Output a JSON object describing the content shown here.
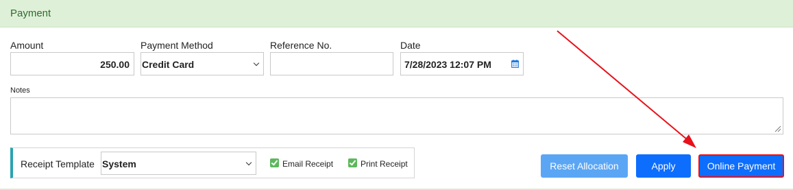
{
  "panel": {
    "title": "Payment"
  },
  "form": {
    "amount_label": "Amount",
    "amount_value": "250.00",
    "payment_method_label": "Payment Method",
    "payment_method_value": "Credit Card",
    "reference_label": "Reference No.",
    "reference_value": "",
    "date_label": "Date",
    "date_value": "7/28/2023 12:07 PM",
    "notes_label": "Notes",
    "notes_value": ""
  },
  "receipt": {
    "label": "Receipt Template",
    "template_value": "System",
    "email_label": "Email Receipt",
    "email_checked": true,
    "print_label": "Print Receipt",
    "print_checked": true
  },
  "actions": {
    "reset_label": "Reset Allocation",
    "apply_label": "Apply",
    "online_label": "Online Payment"
  },
  "colors": {
    "header_bg": "#dff0d8",
    "primary": "#0d6efd",
    "annotation": "#e8101a",
    "accent_bar": "#2aa3b1"
  }
}
